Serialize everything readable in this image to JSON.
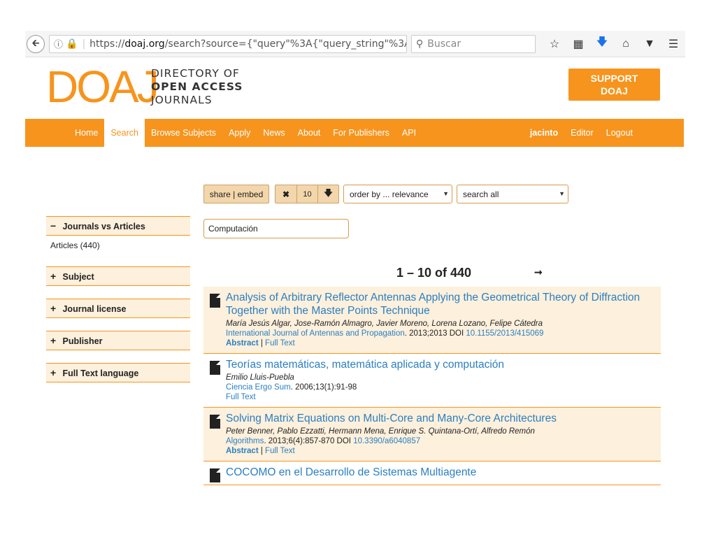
{
  "browser": {
    "url_prefix": "https://",
    "url_domain": "doaj.org",
    "url_rest": "/search?source={\"query\"%3A{\"query_string\"%3A{\"",
    "search_placeholder": "Buscar"
  },
  "header": {
    "logo": "DOAJ",
    "logo_lines": [
      "DIRECTORY OF",
      "OPEN ACCESS",
      "JOURNALS"
    ],
    "support": [
      "SUPPORT",
      "DOAJ"
    ]
  },
  "nav": {
    "items": [
      "Home",
      "Search",
      "Browse Subjects",
      "Apply",
      "News",
      "About",
      "For Publishers",
      "API"
    ],
    "user": "jacinto",
    "editor": "Editor",
    "logout": "Logout"
  },
  "sidebar": {
    "facets": [
      {
        "sign": "−",
        "label": "Journals vs Articles"
      },
      {
        "sign": "+",
        "label": "Subject"
      },
      {
        "sign": "+",
        "label": "Journal license"
      },
      {
        "sign": "+",
        "label": "Publisher"
      },
      {
        "sign": "+",
        "label": "Full Text language"
      }
    ],
    "articles_value": "Articles (440)"
  },
  "toolbar": {
    "share": "share | embed",
    "clear": "✖",
    "page_size": "10",
    "download": "🡇",
    "order": "order by ... relevance",
    "field": "search all"
  },
  "query": "Computación",
  "pager": {
    "range": "1 – 10 of 440",
    "next": "➞"
  },
  "results": [
    {
      "title": "Analysis of Arbitrary Reflector Antennas Applying the Geometrical Theory of Diffraction Together with the Master Points Technique",
      "authors": "María Jesús Algar, Jose-Ramón Almagro, Javier Moreno, Lorena Lozano, Felipe Cátedra",
      "journal": "International Journal of Antennas and Propagation",
      "citation": ". 2013;2013 DOI ",
      "doi": "10.1155/2013/415069",
      "abstract": "Abstract",
      "sep": " | ",
      "fulltext": "Full Text"
    },
    {
      "title": "Teorías matemáticas, matemática aplicada y computación",
      "authors": "Emilio Lluis-Puebla",
      "journal": "Ciencia Ergo Sum",
      "citation": ". 2006;13(1):91-98",
      "fulltext": "Full Text"
    },
    {
      "title": "Solving Matrix Equations on Multi-Core and Many-Core Architectures",
      "authors": "Peter Benner, Pablo Ezzatti, Hermann Mena, Enrique S. Quintana-Ortí, Alfredo Remón",
      "journal": "Algorithms",
      "citation": ". 2013;6(4):857-870 DOI ",
      "doi": "10.3390/a6040857",
      "abstract": "Abstract",
      "sep": " | ",
      "fulltext": "Full Text"
    },
    {
      "title": "COCOMO en el Desarrollo de Sistemas Multiagente"
    }
  ]
}
